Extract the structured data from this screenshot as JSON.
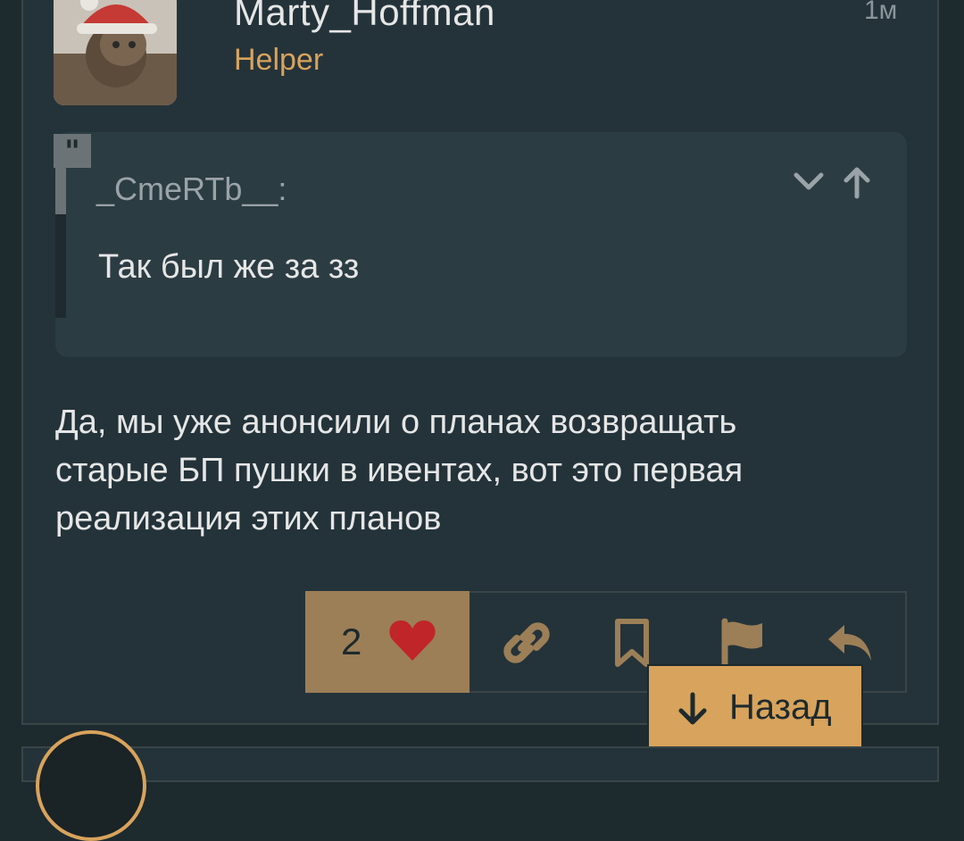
{
  "post": {
    "author": "Marty_Hoffman",
    "role": "Helper",
    "time": "1м",
    "quote": {
      "author": "_CmeRTb__:",
      "text": "Так был же за зз"
    },
    "message": "Да, мы уже анонсили о планах возвращать старые БП пушки в ивентах, вот это первая реализация этих планов",
    "likes": "2"
  },
  "back_button": {
    "label": "Назад"
  },
  "colors": {
    "background": "#1d2a2e",
    "accent": "#d8a35c",
    "like": "#9c7f57",
    "heart": "#c0252a"
  }
}
